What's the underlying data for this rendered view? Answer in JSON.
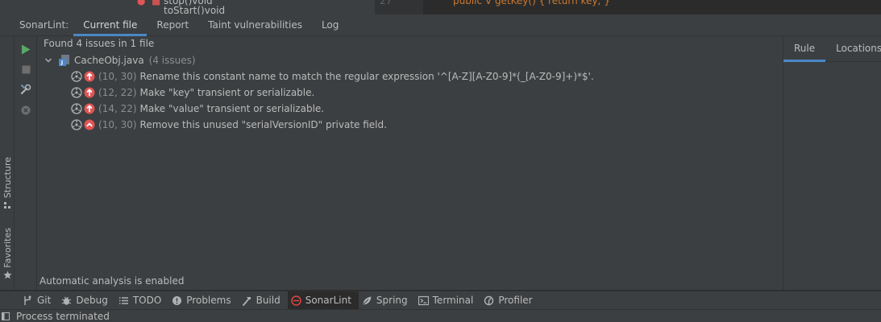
{
  "editor_strip": {
    "left_text": "stop()void",
    "left_text_2": "toStart()void",
    "line_number": "27",
    "code_text": "public V getKey() { return key; }"
  },
  "tool_window": {
    "title": "SonarLint:",
    "tabs": [
      {
        "label": "Current file",
        "active": true
      },
      {
        "label": "Report",
        "active": false
      },
      {
        "label": "Taint vulnerabilities",
        "active": false
      },
      {
        "label": "Log",
        "active": false
      }
    ]
  },
  "side_tabs": {
    "structure": "Structure",
    "favorites": "Favorites"
  },
  "summary": "Found 4 issues in 1 file",
  "file": {
    "name": "CacheObj.java",
    "count": "(4 issues)"
  },
  "issues": [
    {
      "location": "(10, 30)",
      "message": "Rename this constant name to match the regular expression '^[A-Z][A-Z0-9]*(_[A-Z0-9]+)*$'.",
      "severity": "critical"
    },
    {
      "location": "(12, 22)",
      "message": "Make \"key\" transient or serializable.",
      "severity": "critical"
    },
    {
      "location": "(14, 22)",
      "message": "Make \"value\" transient or serializable.",
      "severity": "critical"
    },
    {
      "location": "(10, 30)",
      "message": "Remove this unused \"serialVersionID\" private field.",
      "severity": "major"
    }
  ],
  "auto_analysis": "Automatic analysis is enabled",
  "right_panel": {
    "tabs": [
      {
        "label": "Rule",
        "active": true
      },
      {
        "label": "Locations",
        "active": false
      }
    ]
  },
  "bottom_bar": {
    "items": [
      {
        "label": "Git",
        "icon": "git-branch-icon"
      },
      {
        "label": "Debug",
        "icon": "bug-icon"
      },
      {
        "label": "TODO",
        "icon": "list-icon"
      },
      {
        "label": "Problems",
        "icon": "warning-icon"
      },
      {
        "label": "Build",
        "icon": "hammer-icon"
      },
      {
        "label": "SonarLint",
        "icon": "sonarlint-icon",
        "active": true
      },
      {
        "label": "Spring",
        "icon": "spring-leaf-icon"
      },
      {
        "label": "Terminal",
        "icon": "terminal-icon"
      },
      {
        "label": "Profiler",
        "icon": "profiler-icon"
      }
    ]
  },
  "status": "Process terminated",
  "colors": {
    "accent": "#4a88c7",
    "critical": "#e05555",
    "run_green": "#59a869",
    "sonar_red": "#e04646"
  }
}
